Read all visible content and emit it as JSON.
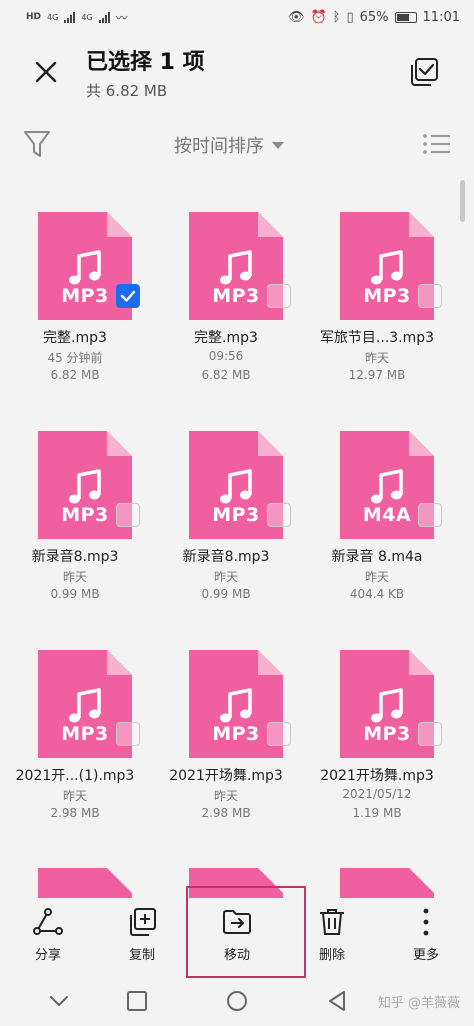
{
  "status_bar": {
    "left": [
      "HD",
      "4G",
      "4G"
    ],
    "battery": "65%",
    "time": "11:01"
  },
  "header": {
    "title": "已选择 1 项",
    "subtitle": "共 6.82 MB",
    "close_icon": "close-icon",
    "select_all_icon": "select-all-icon"
  },
  "sortbar": {
    "sort_label": "按时间排序",
    "filter_icon": "filter-icon",
    "view_icon": "list-view-icon"
  },
  "files": [
    {
      "ext": "MP3",
      "name": "完整.mp3",
      "date": "45 分钟前",
      "size": "6.82 MB",
      "checked": true
    },
    {
      "ext": "MP3",
      "name": "完整.mp3",
      "date": "09:56",
      "size": "6.82 MB",
      "checked": false
    },
    {
      "ext": "MP3",
      "name": "军旅节目...3.mp3",
      "date": "昨天",
      "size": "12.97 MB",
      "checked": false
    },
    {
      "ext": "MP3",
      "name": "新录音8.mp3",
      "date": "昨天",
      "size": "0.99 MB",
      "checked": false
    },
    {
      "ext": "MP3",
      "name": "新录音8.mp3",
      "date": "昨天",
      "size": "0.99 MB",
      "checked": false
    },
    {
      "ext": "M4A",
      "name": "新录音 8.m4a",
      "date": "昨天",
      "size": "404.4 KB",
      "checked": false
    },
    {
      "ext": "MP3",
      "name": "2021开...(1).mp3",
      "date": "昨天",
      "size": "2.98 MB",
      "checked": false
    },
    {
      "ext": "MP3",
      "name": "2021开场舞.mp3",
      "date": "昨天",
      "size": "2.98 MB",
      "checked": false
    },
    {
      "ext": "MP3",
      "name": "2021开场舞.mp3",
      "date": "2021/05/12",
      "size": "1.19 MB",
      "checked": false
    }
  ],
  "toolbar": {
    "share": "分享",
    "copy": "复制",
    "move": "移动",
    "delete": "删除",
    "more": "更多"
  },
  "watermark": "知乎 @羊薇薇",
  "colors": {
    "file_icon": "#f05fa0",
    "file_fold": "#f7b1cf",
    "check_active": "#1d6bf0",
    "highlight": "#c0336b"
  }
}
